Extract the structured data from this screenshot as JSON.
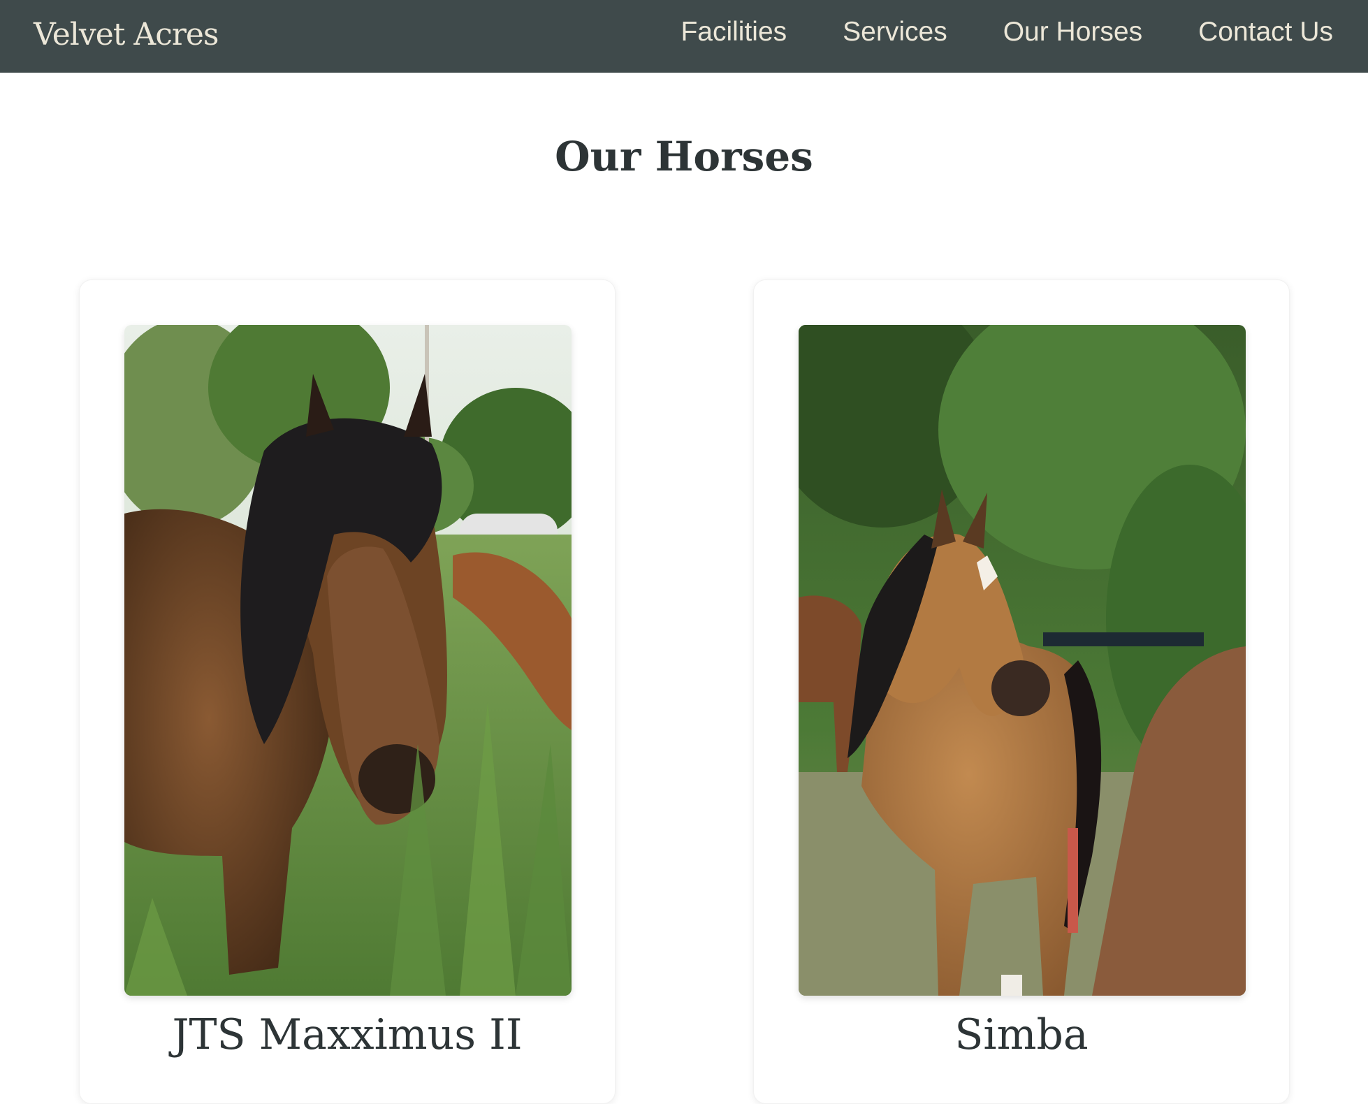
{
  "header": {
    "brand": "Velvet Acres",
    "nav": [
      {
        "label": "Facilities"
      },
      {
        "label": "Services"
      },
      {
        "label": "Our Horses"
      },
      {
        "label": "Contact Us"
      }
    ]
  },
  "main": {
    "title": "Our Horses",
    "horses": [
      {
        "name": "JTS Maxximus II"
      },
      {
        "name": "Simba"
      }
    ]
  },
  "colors": {
    "navbar": "#3f4a4b",
    "nav_text": "#ece7d8",
    "heading_text": "#2d3436"
  }
}
